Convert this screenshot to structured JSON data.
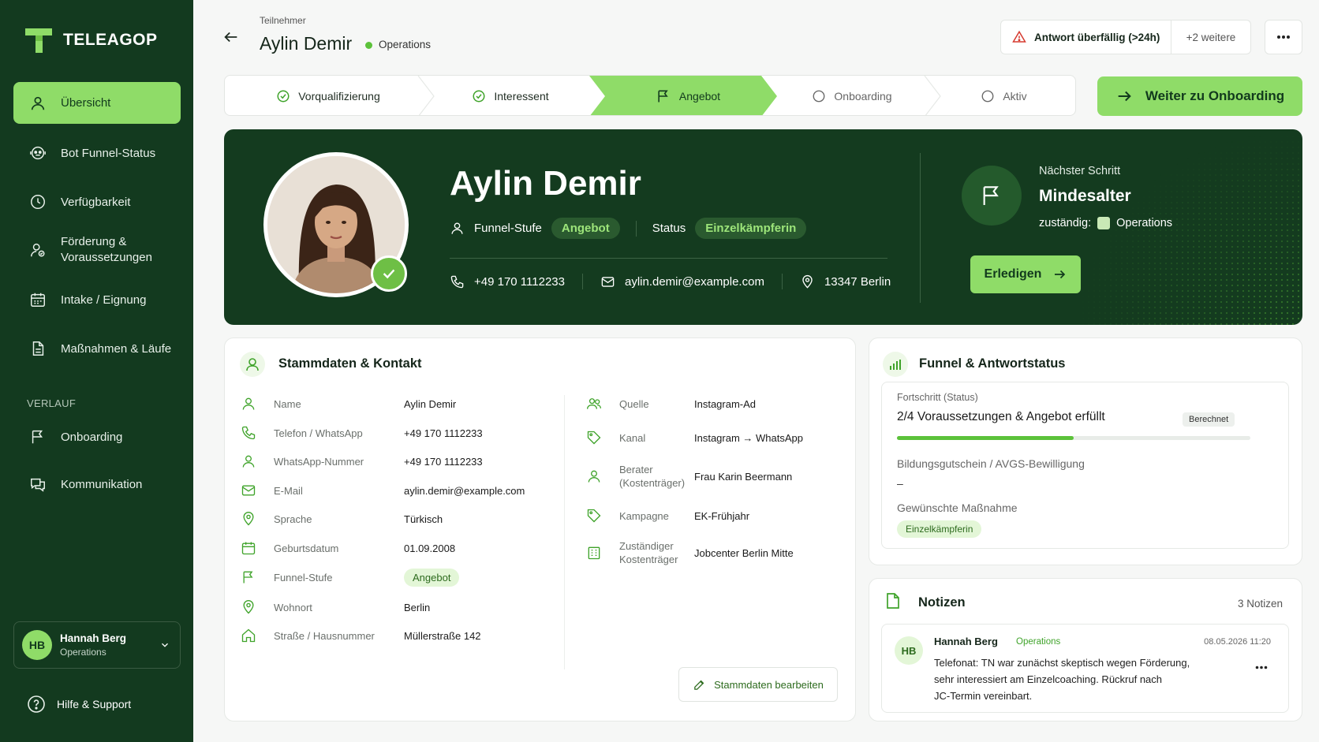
{
  "sidebar": {
    "brand": "TELEAGOP",
    "items": [
      {
        "label": "Übersicht",
        "icon": "user-icon",
        "active": true
      },
      {
        "label": "Bot Funnel-Status",
        "icon": "bot-icon"
      },
      {
        "label": "Verfügbarkeit",
        "icon": "clock-icon"
      },
      {
        "label": "Förderung &",
        "label2": "Voraussetzungen",
        "icon": "user-check-icon"
      },
      {
        "label": "Intake / Eignung",
        "icon": "calendar-icon"
      },
      {
        "label": "Maßnahmen & Läufe",
        "icon": "document-icon"
      }
    ],
    "section_label": "VERLAUF",
    "history_items": [
      {
        "label": "Onboarding",
        "icon": "flag-icon"
      },
      {
        "label": "Kommunikation",
        "icon": "chat-icon"
      }
    ],
    "user": {
      "initials": "HB",
      "name": "Hannah Berg",
      "role": "Operations"
    },
    "help_label": "Hilfe & Support"
  },
  "header": {
    "breadcrumb": "Teilnehmer",
    "title": "Aylin Demir",
    "team": "Operations",
    "alert_label": "Antwort überfällig (>24h)",
    "alert_more": "+2 weitere"
  },
  "stepper": {
    "steps": [
      {
        "label": "Vorqualifizierung",
        "state": "done"
      },
      {
        "label": "Interessent",
        "state": "done"
      },
      {
        "label": "Angebot",
        "state": "active"
      },
      {
        "label": "Onboarding",
        "state": "pending"
      },
      {
        "label": "Aktiv",
        "state": "pending"
      }
    ],
    "cta_label": "Weiter zu Onboarding"
  },
  "hero": {
    "name": "Aylin Demir",
    "funnel_label": "Funnel-Stufe",
    "funnel_value": "Angebot",
    "status_label": "Status",
    "status_value": "Einzelkämpferin",
    "phone": "+49 170 1112233",
    "email": "aylin.demir@example.com",
    "location": "13347 Berlin",
    "next_step_label": "Nächster Schritt",
    "next_step_title": "Mindesalter",
    "owner_label": "zuständig:",
    "owner_value": "Operations",
    "done_label": "Erledigen"
  },
  "stammdaten": {
    "title": "Stammdaten & Kontakt",
    "left": [
      {
        "label": "Name",
        "value": "Aylin Demir",
        "icon": "user-icon"
      },
      {
        "label": "Telefon / WhatsApp",
        "value": "+49 170 1112233",
        "icon": "phone-icon"
      },
      {
        "label": "WhatsApp-Nummer",
        "value": "+49 170 1112233",
        "icon": "user-icon"
      },
      {
        "label": "E-Mail",
        "value": "aylin.demir@example.com",
        "icon": "mail-icon"
      },
      {
        "label": "Sprache",
        "value": "Türkisch",
        "icon": "pin-icon"
      },
      {
        "label": "Geburtsdatum",
        "value": "01.09.2008",
        "icon": "calendar-icon"
      },
      {
        "label": "Funnel-Stufe",
        "value": "Angebot",
        "icon": "flag-icon",
        "pill": true
      },
      {
        "label": "Wohnort",
        "value": "Berlin",
        "icon": "pin-icon"
      },
      {
        "label": "Straße / Hausnummer",
        "value": "Müllerstraße 142",
        "icon": "home-icon"
      }
    ],
    "right": [
      {
        "label": "Quelle",
        "value": "Instagram-Ad",
        "icon": "users-icon"
      },
      {
        "label": "Kanal",
        "value": "Instagram → WhatsApp",
        "icon": "tag-icon"
      },
      {
        "label": "Berater",
        "label2": "(Kostenträger)",
        "value": "Frau Karin Beermann",
        "icon": "user-icon"
      },
      {
        "label": "Kampagne",
        "value": "EK-Frühjahr",
        "icon": "tag-icon"
      },
      {
        "label": "Zuständiger",
        "label2": "Kostenträger",
        "value": "Jobcenter Berlin Mitte",
        "icon": "building-icon"
      }
    ],
    "edit_label": "Stammdaten bearbeiten"
  },
  "funnel": {
    "title": "Funnel & Antwortstatus",
    "progress_label": "Fortschritt (Status)",
    "progress_text": "2/4 Voraussetzungen & Angebot erfüllt",
    "progress_tag": "Berechnet",
    "progress_fraction": 0.5,
    "gutschein_label": "Bildungsgutschein / AVGS-Bewilligung",
    "gutschein_value": "–",
    "massnahme_label": "Gewünschte Maßnahme",
    "massnahme_value": "Einzelkämpferin"
  },
  "notes": {
    "title": "Notizen",
    "count": "3 Notizen",
    "items": [
      {
        "initials": "HB",
        "author": "Hannah Berg",
        "team": "Operations",
        "date": "08.05.2026 11:20",
        "line1": "Telefonat: TN war zunächst skeptisch wegen Förderung,",
        "line2": "sehr interessiert am Einzelcoaching. Rückruf nach",
        "line3": "JC-Termin vereinbart."
      }
    ]
  },
  "colors": {
    "sidebar": "#133a1f",
    "accent": "#8fdc68",
    "hero": "#143b1f",
    "success": "#5cc23a"
  }
}
